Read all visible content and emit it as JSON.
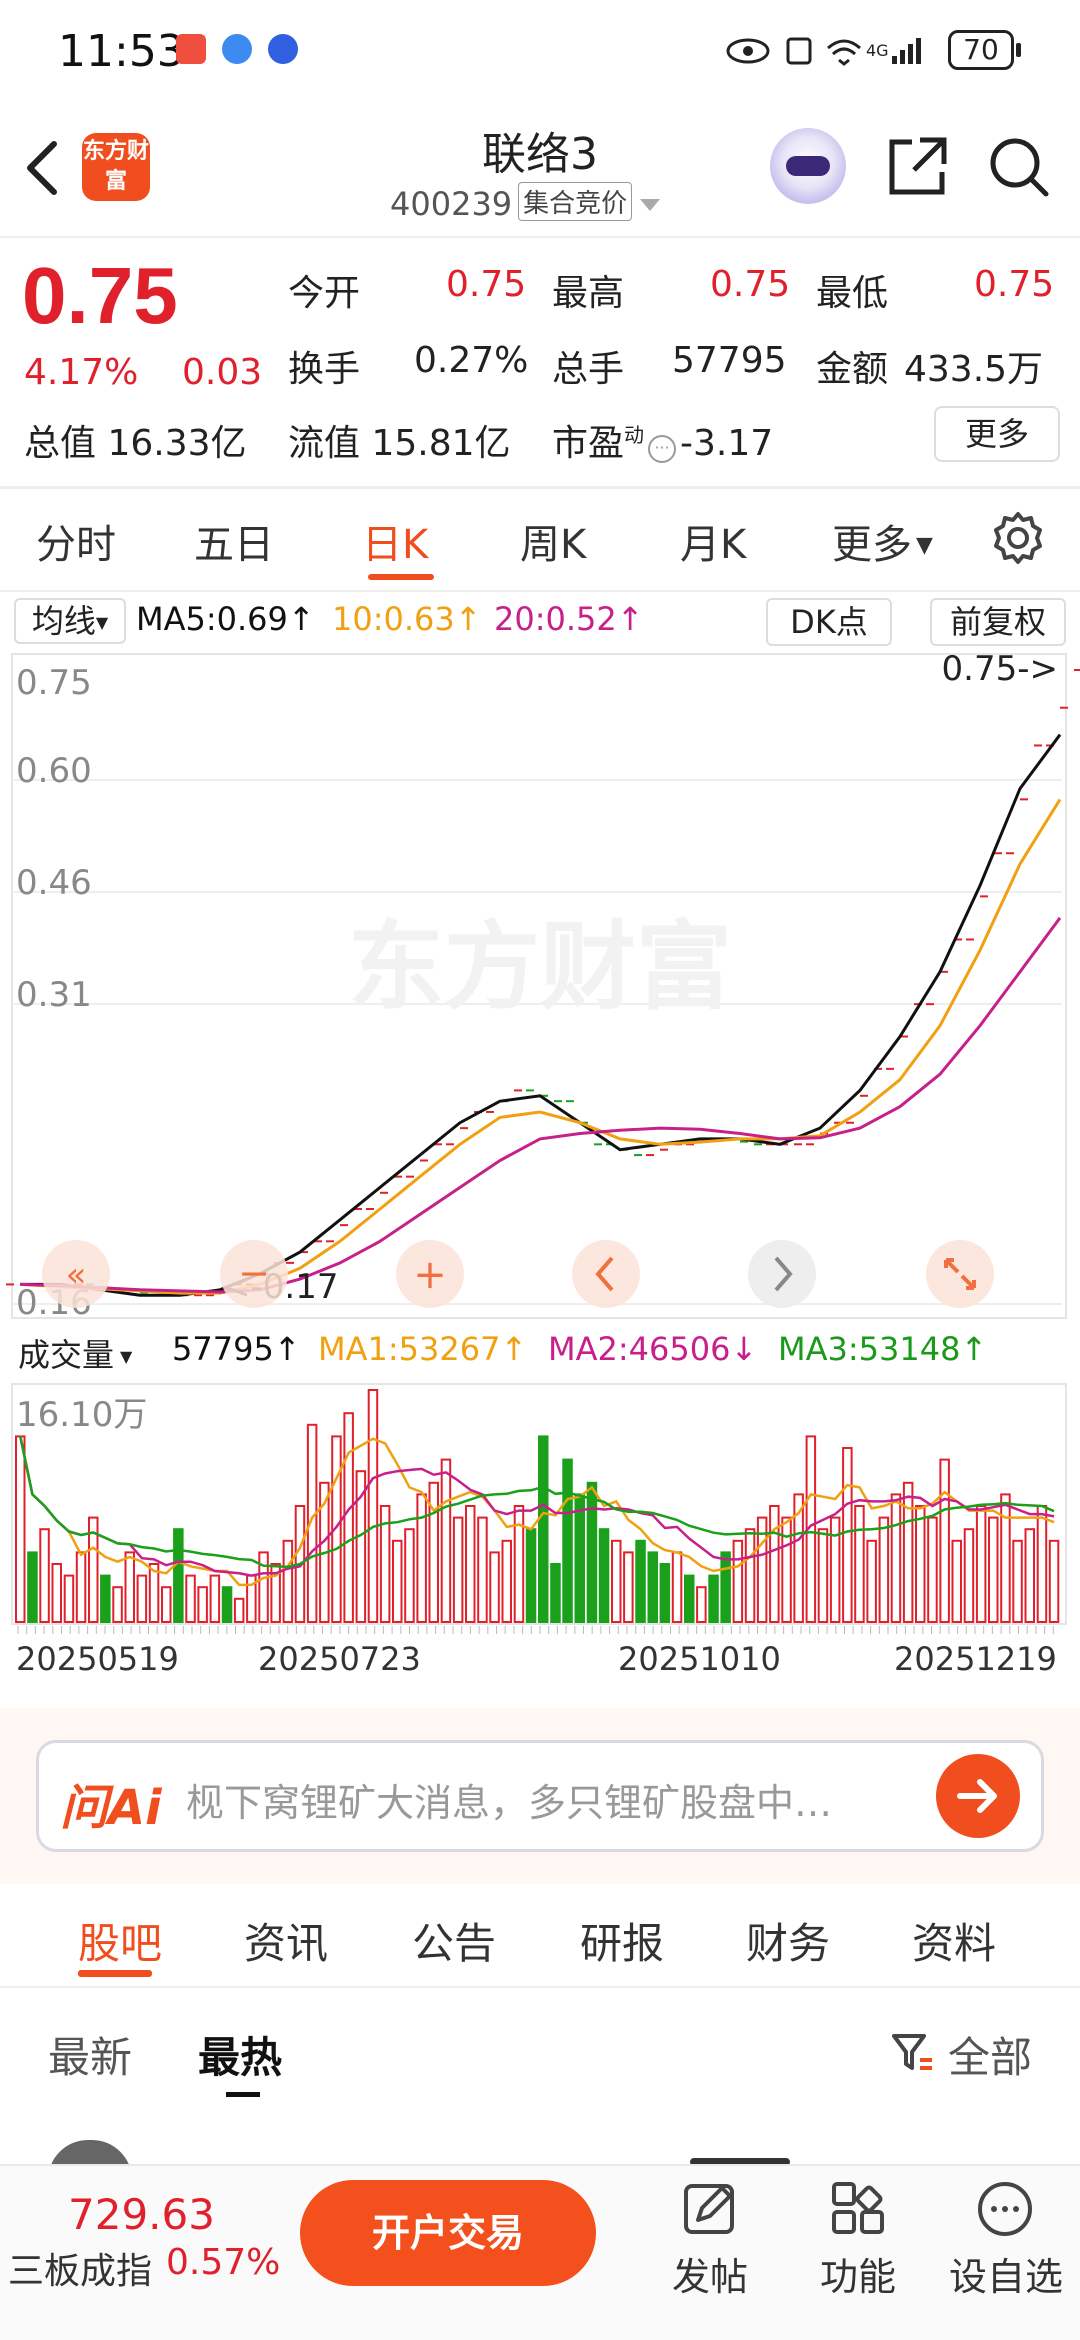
{
  "status_bar": {
    "time": "11:53",
    "battery": "70"
  },
  "header": {
    "logo_text": "东方财富",
    "stock_name": "联络3",
    "stock_code": "400239",
    "auction_tag": "集合竞价"
  },
  "quote": {
    "price": "0.75",
    "change_pct": "4.17%",
    "change": "0.03",
    "market_cap_label": "总值",
    "market_cap": "16.33亿",
    "float_cap_label": "流值",
    "float_cap": "15.81亿",
    "pe_label": "市盈",
    "pe_superscript": "动",
    "pe_value": "-3.17",
    "open_label": "今开",
    "open": "0.75",
    "high_label": "最高",
    "high": "0.75",
    "low_label": "最低",
    "low": "0.75",
    "turnover_label": "换手",
    "turnover": "0.27%",
    "volume_label": "总手",
    "volume": "57795",
    "amount_label": "金额",
    "amount": "433.5万",
    "more_button": "更多"
  },
  "chart_tabs": [
    {
      "label": "分时"
    },
    {
      "label": "五日"
    },
    {
      "label": "日K"
    },
    {
      "label": "周K"
    },
    {
      "label": "月K"
    },
    {
      "label": "更多"
    }
  ],
  "ma_legend": {
    "type_selector": "均线",
    "ma5": "MA5:0.69↑",
    "ma10": "10:0.63↑",
    "ma20": "20:0.52↑",
    "dk_button": "DK点",
    "adjust_button": "前复权"
  },
  "volume_legend": {
    "selector": "成交量",
    "volume": "57795↑",
    "ma1": "MA1:53267↑",
    "ma2": "MA2:46506↓",
    "ma3": "MA3:53148↑"
  },
  "colors": {
    "accent": "#f04e1e",
    "up": "#e0202b",
    "down": "#1aa01a",
    "ma5": "#111111",
    "ma10": "#f0a010",
    "ma20": "#c8208a"
  },
  "watermark": "东方财富",
  "chart_data": [
    {
      "type": "candlestick",
      "y_axis_labels": [
        "0.75",
        "0.60",
        "0.46",
        "0.31",
        "0.16"
      ],
      "ylim": [
        0.16,
        0.75
      ],
      "last_price_marker": "0.75->",
      "min_marker": "<-0.17",
      "ma_series": [
        {
          "name": "MA5",
          "values": [
            0.18,
            0.18,
            0.175,
            0.17,
            0.17,
            0.175,
            0.19,
            0.21,
            0.24,
            0.27,
            0.3,
            0.33,
            0.35,
            0.355,
            0.33,
            0.305,
            0.31,
            0.315,
            0.315,
            0.31,
            0.325,
            0.36,
            0.41,
            0.47,
            0.55,
            0.64,
            0.69
          ]
        },
        {
          "name": "MA10",
          "values": [
            0.18,
            0.178,
            0.176,
            0.174,
            0.172,
            0.172,
            0.18,
            0.195,
            0.22,
            0.25,
            0.28,
            0.31,
            0.335,
            0.34,
            0.33,
            0.315,
            0.31,
            0.312,
            0.315,
            0.315,
            0.318,
            0.34,
            0.37,
            0.42,
            0.49,
            0.57,
            0.63
          ]
        },
        {
          "name": "MA20",
          "values": [
            0.18,
            0.179,
            0.177,
            0.175,
            0.174,
            0.173,
            0.175,
            0.185,
            0.2,
            0.22,
            0.245,
            0.27,
            0.295,
            0.315,
            0.32,
            0.323,
            0.325,
            0.324,
            0.32,
            0.315,
            0.316,
            0.325,
            0.345,
            0.375,
            0.42,
            0.47,
            0.52
          ]
        }
      ],
      "candles": [
        0.18,
        0.18,
        0.175,
        0.17,
        0.17,
        0.18,
        0.2,
        0.22,
        0.25,
        0.28,
        0.31,
        0.34,
        0.36,
        0.35,
        0.31,
        0.3,
        0.31,
        0.315,
        0.31,
        0.31,
        0.33,
        0.38,
        0.44,
        0.5,
        0.58,
        0.68,
        0.75
      ]
    },
    {
      "type": "bar",
      "y_axis_labels": [
        "16.10万"
      ],
      "x_tick_labels": [
        "20250519",
        "20250723",
        "20251010",
        "20251219"
      ],
      "volume_values": [
        0.8,
        0.3,
        0.4,
        0.25,
        0.2,
        0.3,
        0.45,
        0.2,
        0.15,
        0.3,
        0.2,
        0.25,
        0.15,
        0.4,
        0.2,
        0.15,
        0.2,
        0.15,
        0.1,
        0.2,
        0.3,
        0.25,
        0.35,
        0.5,
        0.85,
        0.6,
        0.8,
        0.9,
        0.65,
        1.0,
        0.5,
        0.35,
        0.4,
        0.55,
        0.6,
        0.7,
        0.45,
        0.5,
        0.45,
        0.3,
        0.35,
        0.5,
        0.4,
        0.8,
        0.25,
        0.7,
        0.55,
        0.6,
        0.4,
        0.35,
        0.3,
        0.35,
        0.3,
        0.25,
        0.3,
        0.2,
        0.15,
        0.2,
        0.3,
        0.35,
        0.4,
        0.45,
        0.5,
        0.45,
        0.55,
        0.8,
        0.4,
        0.45,
        0.75,
        0.5,
        0.35,
        0.45,
        0.55,
        0.6,
        0.5,
        0.45,
        0.7,
        0.35,
        0.4,
        0.5,
        0.45,
        0.55,
        0.35,
        0.4,
        0.5,
        0.35
      ],
      "down_flags": [
        0,
        1,
        0,
        0,
        0,
        0,
        0,
        1,
        0,
        0,
        0,
        0,
        0,
        1,
        0,
        0,
        0,
        1,
        0,
        0,
        0,
        0,
        0,
        0,
        0,
        0,
        0,
        0,
        0,
        0,
        0,
        0,
        0,
        0,
        0,
        0,
        0,
        0,
        0,
        0,
        0,
        0,
        1,
        1,
        1,
        1,
        1,
        1,
        1,
        0,
        0,
        1,
        1,
        1,
        0,
        1,
        0,
        1,
        1,
        0,
        0,
        0,
        0,
        0,
        0,
        0,
        0,
        0,
        0,
        0,
        0,
        0,
        0,
        0,
        0,
        0,
        0,
        0,
        0,
        0,
        0,
        0,
        0,
        0,
        0,
        0
      ]
    }
  ],
  "ask_ai": {
    "logo": "问Ai",
    "prompt": "枧下窝锂矿大消息，多只锂矿股盘中…"
  },
  "content_tabs": [
    {
      "label": "股吧"
    },
    {
      "label": "资讯"
    },
    {
      "label": "公告"
    },
    {
      "label": "研报"
    },
    {
      "label": "财务"
    },
    {
      "label": "资料"
    }
  ],
  "sort_tabs": {
    "latest": "最新",
    "hottest": "最热",
    "filter": "全部"
  },
  "bottom_bar": {
    "index_value": "729.63",
    "index_name": "三板成指",
    "index_change": "0.57%",
    "trade_button": "开户交易",
    "post": "发帖",
    "functions": "功能",
    "watchlist": "设自选"
  }
}
